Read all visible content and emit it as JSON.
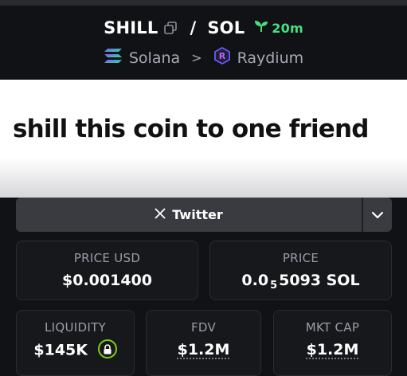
{
  "pair": {
    "base": "SHILL",
    "separator": "/",
    "quote": "SOL",
    "age": "20m"
  },
  "chain": {
    "network": "Solana",
    "dex": "Raydium"
  },
  "banner": {
    "text": "shill this coin to one friend"
  },
  "social": {
    "twitter_label": "Twitter"
  },
  "stats": {
    "price_usd_label": "PRICE USD",
    "price_usd_value": "$0.001400",
    "price_label": "PRICE",
    "price_prefix": "0.0",
    "price_zeros": "5",
    "price_suffix": "5093 SOL",
    "liquidity_label": "LIQUIDITY",
    "liquidity_value": "$145K",
    "fdv_label": "FDV",
    "fdv_value": "$1.2M",
    "mktcap_label": "MKT CAP",
    "mktcap_value": "$1.2M"
  },
  "colors": {
    "age_green": "#4ade80",
    "lock_green": "#84cc16",
    "card_bg": "#17181c"
  },
  "icons": {
    "copy": "copy-icon",
    "sprout": "sprout-icon",
    "solana": "solana-icon",
    "raydium": "raydium-icon",
    "twitter": "x-icon",
    "chevron": "chevron-down-icon",
    "lock": "lock-icon"
  }
}
